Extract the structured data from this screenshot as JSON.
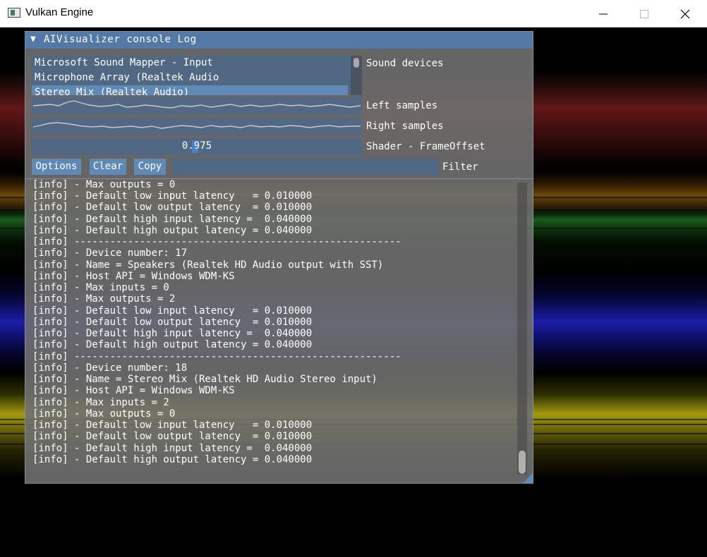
{
  "window": {
    "title": "Vulkan Engine",
    "controls": {
      "minimize": "minimize-icon",
      "maximize": "maximize-icon",
      "close": "close-icon"
    }
  },
  "panel": {
    "title": "AIVisualizer console Log",
    "collapse_icon": "▼"
  },
  "sound_devices": {
    "label": "Sound devices",
    "items": [
      "Microsoft Sound Mapper - Input",
      "Microphone Array (Realtek Audio",
      "Stereo Mix (Realtek Audio)"
    ],
    "selected_index": 2
  },
  "left_samples": {
    "label": "Left samples"
  },
  "right_samples": {
    "label": "Right samples"
  },
  "shader": {
    "label": "Shader - FrameOffset",
    "value": "0.975",
    "fraction": 0.5
  },
  "toolbar": {
    "options_label": "Options",
    "clear_label": "Clear",
    "copy_label": "Copy",
    "filter_label": "Filter",
    "filter_value": ""
  },
  "log": {
    "lines": [
      "[info] - Max outputs = 0",
      "[info] - Default low input latency   = 0.010000",
      "[info] - Default low output latency  = 0.010000",
      "[info] - Default high input latency =  0.040000",
      "[info] - Default high output latency = 0.040000",
      "[info] -------------------------------------------------------",
      "[info] - Device number: 17",
      "[info] - Name = Speakers (Realtek HD Audio output with SST)",
      "[info] - Host API = Windows WDM-KS",
      "[info] - Max inputs = 0",
      "[info] - Max outputs = 2",
      "[info] - Default low input latency   = 0.010000",
      "[info] - Default low output latency  = 0.010000",
      "[info] - Default high input latency =  0.040000",
      "[info] - Default high output latency = 0.040000",
      "[info] -------------------------------------------------------",
      "[info] - Device number: 18",
      "[info] - Name = Stereo Mix (Realtek HD Audio Stereo input)",
      "[info] - Host API = Windows WDM-KS",
      "[info] - Max inputs = 2",
      "[info] - Max outputs = 0",
      "[info] - Default low input latency   = 0.010000",
      "[info] - Default low output latency  = 0.010000",
      "[info] - Default high input latency =  0.040000",
      "[info] - Default high output latency = 0.040000"
    ]
  },
  "colors": {
    "accent": "#5379a6",
    "button": "#5f8ab8",
    "frame_bg": "#4e688a"
  }
}
